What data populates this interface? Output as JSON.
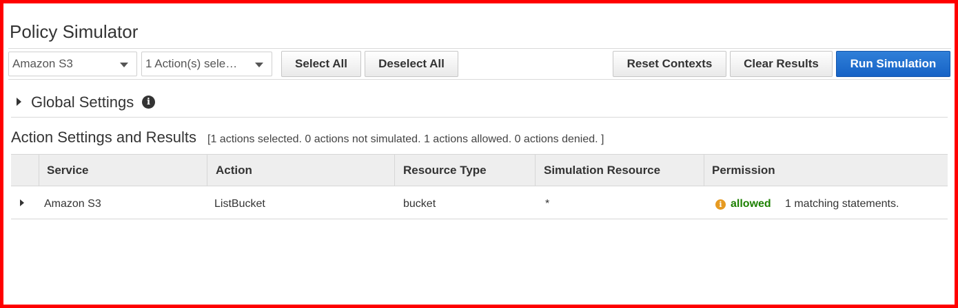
{
  "header": {
    "title": "Policy Simulator"
  },
  "toolbar": {
    "service_select": {
      "value": "Amazon S3"
    },
    "action_select": {
      "value": "1 Action(s) sele…"
    },
    "select_all_label": "Select All",
    "deselect_all_label": "Deselect All",
    "reset_contexts_label": "Reset Contexts",
    "clear_results_label": "Clear Results",
    "run_simulation_label": "Run Simulation"
  },
  "global_settings": {
    "title": "Global Settings",
    "info_glyph": "i"
  },
  "action_settings": {
    "title": "Action Settings and Results",
    "summary": "[1 actions selected. 0 actions not simulated. 1 actions allowed. 0 actions denied. ]"
  },
  "table": {
    "columns": [
      "Service",
      "Action",
      "Resource Type",
      "Simulation Resource",
      "Permission"
    ],
    "rows": [
      {
        "service": "Amazon S3",
        "action": "ListBucket",
        "resource_type": "bucket",
        "simulation_resource": "*",
        "permission_icon": "i",
        "permission": "allowed",
        "matching": "1 matching statements."
      }
    ]
  },
  "colors": {
    "primary_button": "#1763c6",
    "allowed": "#1d8102",
    "info_orange": "#e69a21",
    "frame": "#ff0000"
  }
}
